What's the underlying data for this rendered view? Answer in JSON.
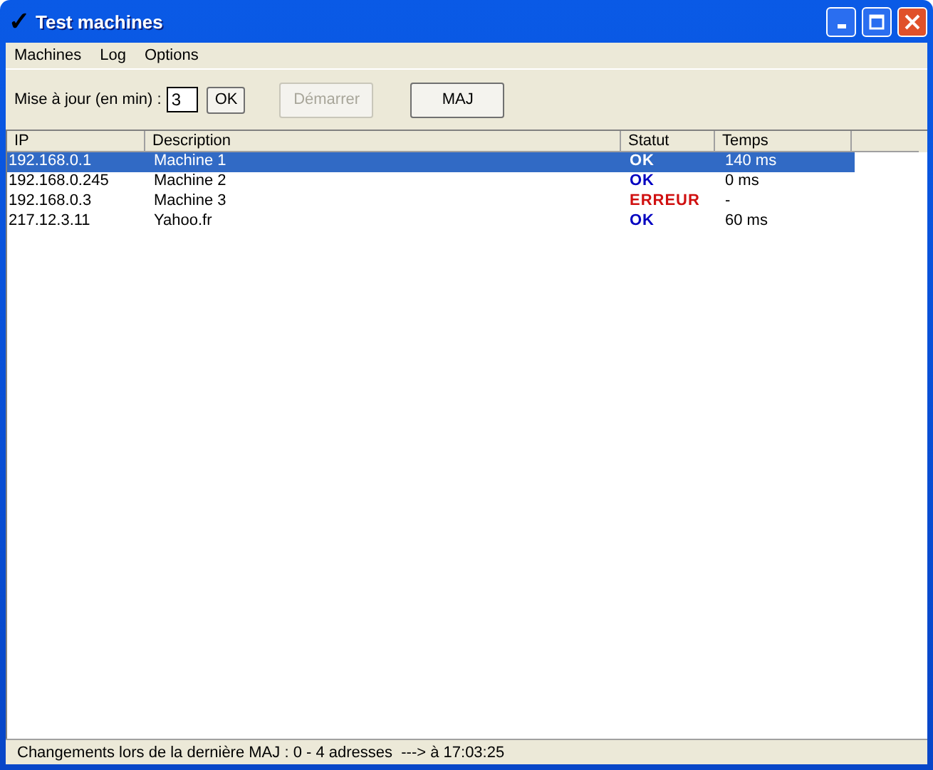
{
  "window": {
    "title": "Test machines",
    "check_mark": "✓"
  },
  "menu": [
    "Machines",
    "Log",
    "Options"
  ],
  "toolbar": {
    "interval_label": "Mise à jour (en min) :",
    "interval_value": "3",
    "buttons": [
      {
        "label": "OK",
        "disabled": false
      },
      {
        "label": "Démarrer",
        "disabled": true
      },
      {
        "label": "MAJ",
        "disabled": false
      }
    ]
  },
  "table": {
    "columns": [
      "IP",
      "Description",
      "Statut",
      "Temps"
    ],
    "rows": [
      {
        "ip": "192.168.0.1",
        "description": "Machine 1",
        "status": "OK",
        "color": "#ffffff",
        "time": "140 ms",
        "selected": true
      },
      {
        "ip": "192.168.0.245",
        "description": "Machine 2",
        "status": "OK",
        "color": "#0000c0",
        "time": "0 ms",
        "selected": false
      },
      {
        "ip": "192.168.0.3",
        "description": "Machine 3",
        "status": "ERREUR",
        "color": "#d01010",
        "time": "-",
        "selected": false
      },
      {
        "ip": "217.12.3.11",
        "description": "Yahoo.fr",
        "status": "OK",
        "color": "#0000c0",
        "time": "60 ms",
        "selected": false
      }
    ]
  },
  "status_bar": "Changements lors de la dernière MAJ : 0 - 4 adresses  ---> à 17:03:25"
}
